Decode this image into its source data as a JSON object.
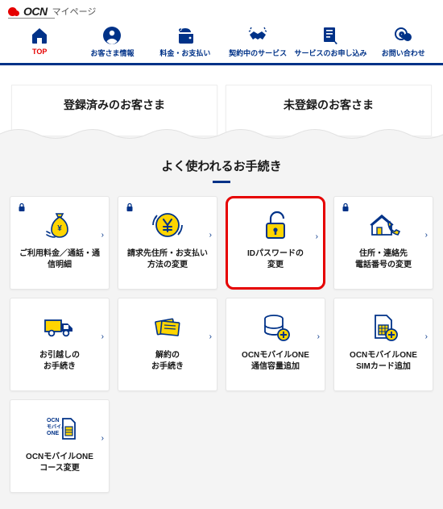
{
  "brand": {
    "name": "OCN",
    "page": "マイページ"
  },
  "nav": [
    {
      "label": "TOP"
    },
    {
      "label": "お客さま情報"
    },
    {
      "label": "料金・お支払い"
    },
    {
      "label": "契約中のサービス"
    },
    {
      "label": "サービスのお申し込み"
    },
    {
      "label": "お問い合わせ"
    }
  ],
  "cols": {
    "left": "登録済みのお客さま",
    "right": "未登録のお客さま"
  },
  "section_title": "よく使われるお手続き",
  "cards": [
    {
      "label": "ご利用料金／通話・通\n信明細",
      "lock": true
    },
    {
      "label": "請求先住所・お支払い\n方法の変更",
      "lock": true
    },
    {
      "label": "IDパスワードの\n変更",
      "lock": false,
      "highlight": true
    },
    {
      "label": "住所・連絡先\n電話番号の変更",
      "lock": true
    },
    {
      "label": "お引越しの\nお手続き"
    },
    {
      "label": "解約の\nお手続き"
    },
    {
      "label": "OCNモバイルONE\n通信容量追加"
    },
    {
      "label": "OCNモバイルONE\nSIMカード追加"
    },
    {
      "label": "OCNモバイルONE\nコース変更"
    }
  ],
  "colors": {
    "navy": "#003288",
    "red": "#e60000",
    "yellow": "#ffd500"
  }
}
